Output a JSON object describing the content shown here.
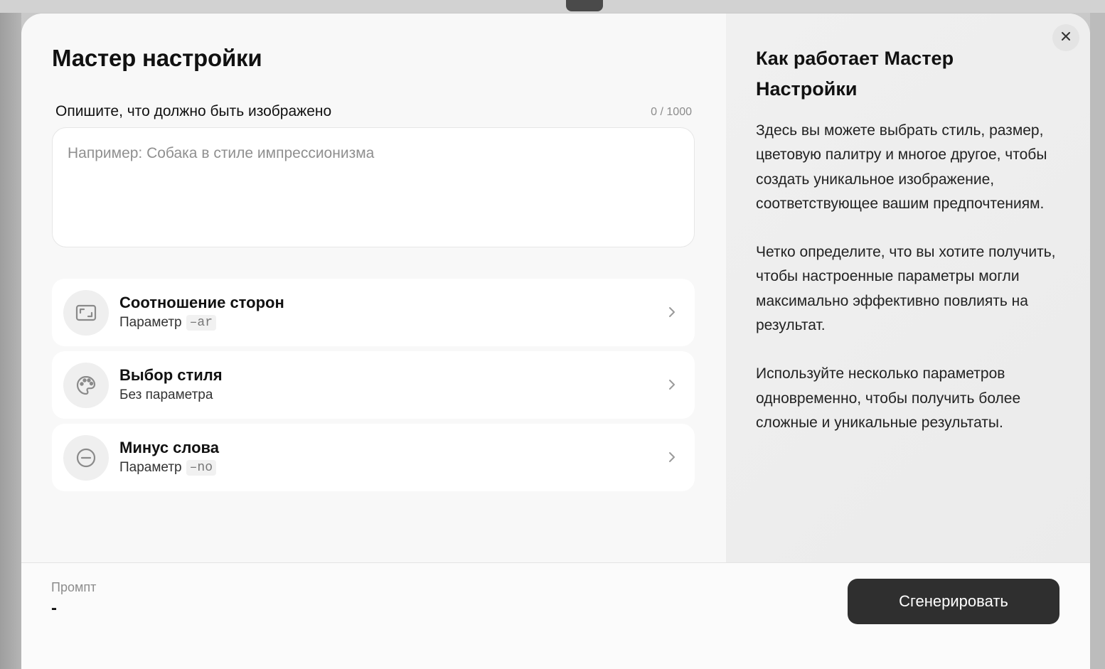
{
  "modal": {
    "title": "Мастер настройки",
    "close_icon": "close-icon"
  },
  "prompt_input": {
    "label": "Опишите, что должно быть изображено",
    "char_count": "0 / 1000",
    "placeholder": "Например: Собака в стиле импрессионизма",
    "value": ""
  },
  "options": [
    {
      "icon": "aspect-ratio-icon",
      "title": "Соотношение сторон",
      "sub_label": "Параметр",
      "param": "–ar"
    },
    {
      "icon": "palette-icon",
      "title": "Выбор стиля",
      "sub_label": "Без параметра",
      "param": ""
    },
    {
      "icon": "minus-circle-icon",
      "title": "Минус слова",
      "sub_label": "Параметр",
      "param": "–no"
    }
  ],
  "help": {
    "title": "Как работает Мастер Настройки",
    "paragraphs": [
      "Здесь вы можете выбрать стиль, размер, цветовую палитру и многое другое, чтобы создать уникальное изображение, соответствующее вашим предпочтениям.",
      "Четко определите, что вы хотите получить, чтобы настроенные параметры могли максимально эффективно повлиять на результат.",
      "Используйте несколько параметров одновременно, чтобы получить более сложные и уникальные результаты."
    ]
  },
  "footer": {
    "prompt_label": "Промпт",
    "prompt_value": "-",
    "generate_label": "Сгенерировать"
  },
  "colors": {
    "button_bg": "#2f2f2f",
    "panel_bg": "#f8f8f8",
    "help_bg": "#eeeeee"
  }
}
